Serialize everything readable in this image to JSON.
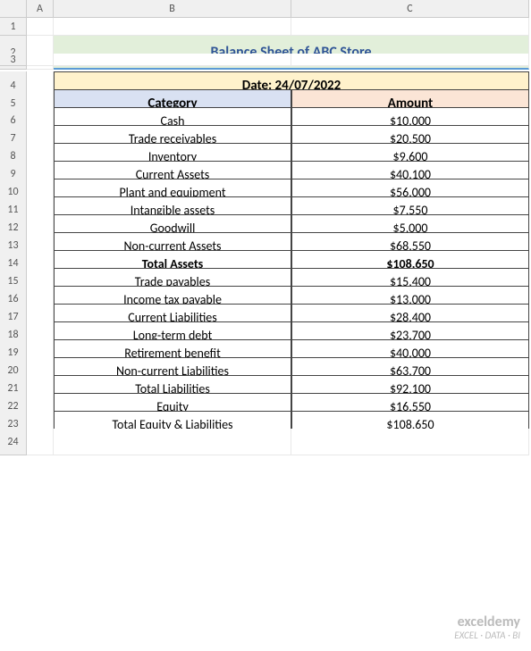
{
  "columns": [
    "A",
    "B",
    "C"
  ],
  "rowcount": 24,
  "title": "Balance Sheet of ABC Store",
  "date_label": "Date: 24/07/2022",
  "headers": {
    "category": "Category",
    "amount": "Amount"
  },
  "rows": [
    {
      "category": "Cash",
      "amount": "$10,000",
      "bold": false
    },
    {
      "category": "Trade receivables",
      "amount": "$20,500",
      "bold": false
    },
    {
      "category": "Inventory",
      "amount": "$9,600",
      "bold": false
    },
    {
      "category": "Current Assets",
      "amount": "$40,100",
      "bold": false
    },
    {
      "category": "Plant and equipment",
      "amount": "$56,000",
      "bold": false
    },
    {
      "category": "Intangible assets",
      "amount": "$7,550",
      "bold": false
    },
    {
      "category": "Goodwill",
      "amount": "$5,000",
      "bold": false
    },
    {
      "category": "Non-current Assets",
      "amount": "$68,550",
      "bold": false
    },
    {
      "category": "Total Assets",
      "amount": "$108,650",
      "bold": true
    },
    {
      "category": "Trade payables",
      "amount": "$15,400",
      "bold": false
    },
    {
      "category": "Income tax payable",
      "amount": "$13,000",
      "bold": false
    },
    {
      "category": "Current Liabilities",
      "amount": "$28,400",
      "bold": false
    },
    {
      "category": "Long-term debt",
      "amount": "$23,700",
      "bold": false
    },
    {
      "category": "Retirement benefit",
      "amount": "$40,000",
      "bold": false
    },
    {
      "category": "Non-current Liabilities",
      "amount": "$63,700",
      "bold": false
    },
    {
      "category": "Total Liabilities",
      "amount": "$92,100",
      "bold": false
    },
    {
      "category": "Equity",
      "amount": "$16,550",
      "bold": false
    },
    {
      "category": "Total Equity & Liabilities",
      "amount": "$108,650",
      "bold": false
    }
  ],
  "watermark": {
    "line1": "exceldemy",
    "line2": "EXCEL · DATA · BI"
  }
}
